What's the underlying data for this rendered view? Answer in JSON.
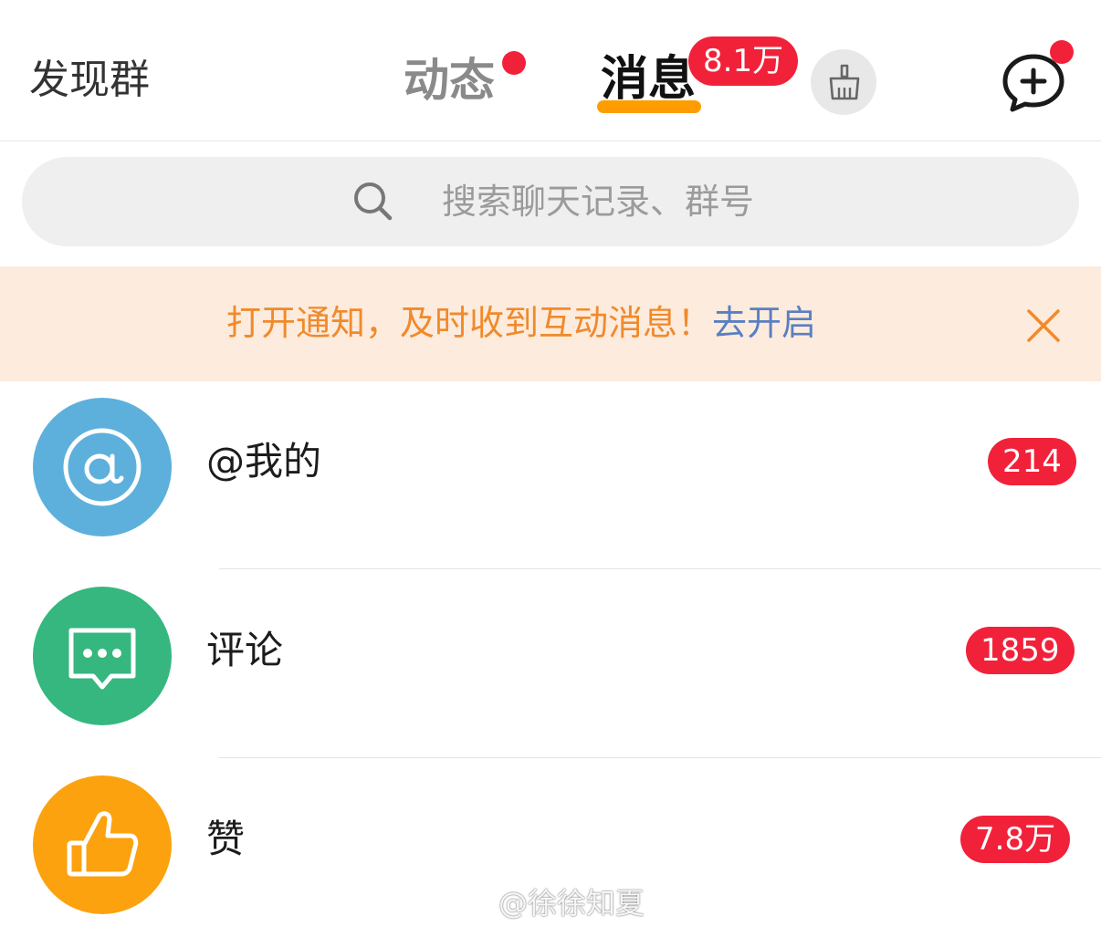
{
  "header": {
    "discover_label": "发现群",
    "tabs": [
      {
        "label": "动态",
        "has_dot": true
      },
      {
        "label": "消息",
        "active": true,
        "badge": "8.1万"
      }
    ],
    "clean_icon": "broom-icon",
    "compose_icon": "chat-plus-icon",
    "compose_has_dot": true
  },
  "search": {
    "placeholder": "搜索聊天记录、群号"
  },
  "banner": {
    "text": "打开通知，及时收到互动消息！",
    "link": "去开启",
    "close_icon": "close-icon"
  },
  "list": [
    {
      "title": "@我的",
      "badge": "214",
      "icon": "at-icon",
      "color": "#5db0dc"
    },
    {
      "title": "评论",
      "badge": "1859",
      "icon": "comment-icon",
      "color": "#35b77f"
    },
    {
      "title": "赞",
      "badge": "7.8万",
      "icon": "thumbs-up-icon",
      "color": "#fca20f"
    }
  ],
  "watermark": {
    "text": "@徐徐知夏"
  },
  "colors": {
    "badge_red": "#f2213a",
    "tab_underline": "#ff9d00",
    "banner_bg": "#fdebdd",
    "banner_text": "#f08a2b",
    "banner_link": "#5a7fc1"
  }
}
